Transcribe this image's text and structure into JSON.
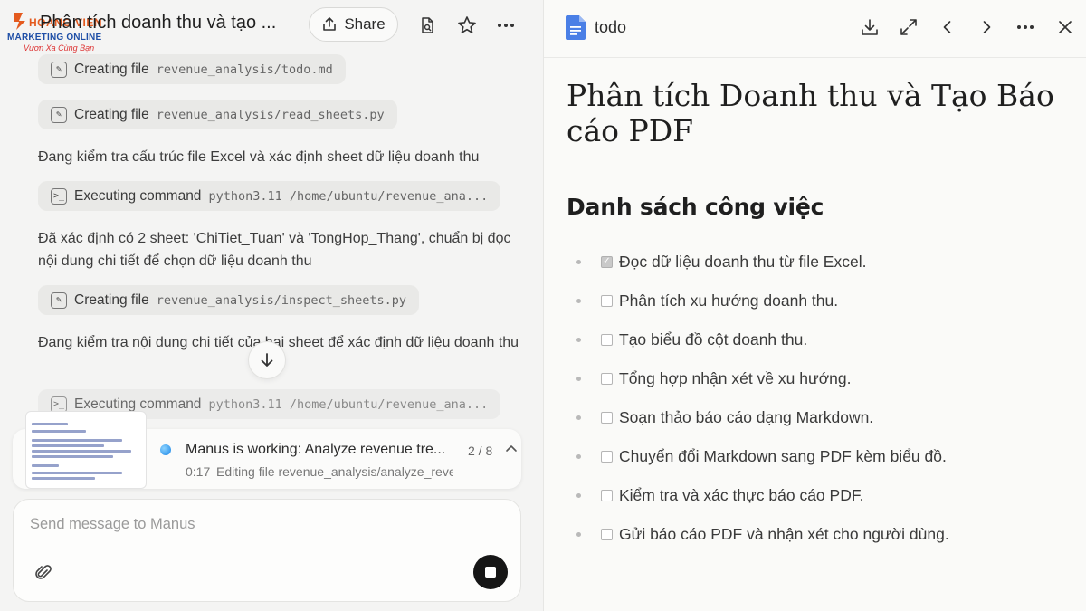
{
  "brand": {
    "name": "HOANG VIEN",
    "line": "MARKETING ONLINE",
    "slogan": "Vươn Xa Cùng Bạn"
  },
  "chat": {
    "title": "Phân tích doanh thu và tạo ...",
    "share_label": "Share"
  },
  "steps": [
    {
      "action": "Creating file",
      "path": "revenue_analysis/todo.md",
      "icon": "edit-icon"
    },
    {
      "action": "Creating file",
      "path": "revenue_analysis/read_sheets.py",
      "icon": "edit-icon"
    },
    {
      "action": "Executing command",
      "path": "python3.11 /home/ubuntu/revenue_ana...",
      "icon": "terminal-icon"
    },
    {
      "action": "Creating file",
      "path": "revenue_analysis/inspect_sheets.py",
      "icon": "edit-icon"
    },
    {
      "action": "Executing command",
      "path": "python3.11 /home/ubuntu/revenue_ana...",
      "icon": "terminal-icon"
    }
  ],
  "messages": [
    "Đang kiểm tra cấu trúc file Excel và xác định sheet dữ liệu doanh thu",
    "Đã xác định có 2 sheet: 'ChiTiet_Tuan' và 'TongHop_Thang', chuẩn bị đọc nội dung chi tiết để chọn dữ liệu doanh thu",
    "Đang kiểm tra nội dung chi tiết của hai sheet để xác định dữ liệu doanh thu"
  ],
  "status": {
    "title": "Manus is working: Analyze revenue tre...",
    "progress": "2 / 8",
    "time": "0:17",
    "subtitle": "Editing file revenue_analysis/analyze_reve"
  },
  "composer": {
    "placeholder": "Send message to Manus"
  },
  "doc": {
    "name": "todo",
    "title": "Phân tích Doanh thu và Tạo Báo cáo PDF",
    "subtitle": "Danh sách công việc",
    "todos": [
      {
        "label": "Đọc dữ liệu doanh thu từ file Excel.",
        "checked": true
      },
      {
        "label": "Phân tích xu hướng doanh thu.",
        "checked": false
      },
      {
        "label": "Tạo biểu đồ cột doanh thu.",
        "checked": false
      },
      {
        "label": "Tổng hợp nhận xét về xu hướng.",
        "checked": false
      },
      {
        "label": "Soạn thảo báo cáo dạng Markdown.",
        "checked": false
      },
      {
        "label": "Chuyển đổi Markdown sang PDF kèm biểu đồ.",
        "checked": false
      },
      {
        "label": "Kiểm tra và xác thực báo cáo PDF.",
        "checked": false
      },
      {
        "label": "Gửi báo cáo PDF và nhận xét cho người dùng.",
        "checked": false
      }
    ]
  },
  "colors": {
    "accent": "#1c86e6",
    "doc_icon": "#4a7fe6",
    "stop_button": "#161616"
  }
}
